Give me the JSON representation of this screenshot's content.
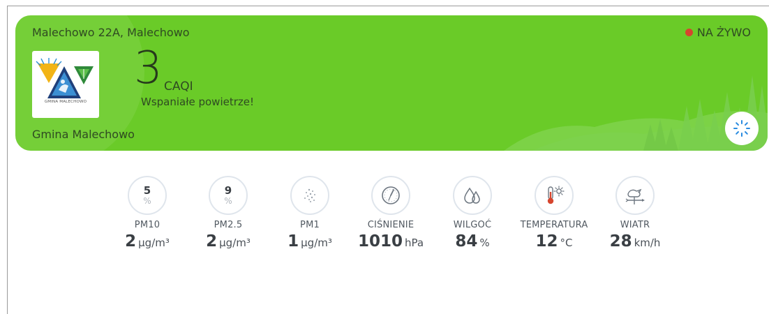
{
  "header": {
    "location": "Malechowo 22A, Malechowo",
    "live_label": "NA ŻYWO",
    "organization": "Gmina Malechowo"
  },
  "logo": {
    "caption": "GMINA MALECHOWO"
  },
  "aqi": {
    "value": "3",
    "unit": "CAQI",
    "description": "Wspaniałe powietrze!"
  },
  "colors": {
    "card_background": "#6acb28",
    "live_dot": "#d6452e",
    "refresh_icon": "#2a8be0"
  },
  "metrics": [
    {
      "id": "pm10",
      "index": "5",
      "index_unit": "%",
      "label": "PM10",
      "value": "2",
      "unit": "µg/m³"
    },
    {
      "id": "pm25",
      "index": "9",
      "index_unit": "%",
      "label": "PM2.5",
      "value": "2",
      "unit": "µg/m³"
    },
    {
      "id": "pm1",
      "icon": "dots-icon",
      "label": "PM1",
      "value": "1",
      "unit": "µg/m³"
    },
    {
      "id": "pressure",
      "icon": "gauge-icon",
      "label": "CIŚNIENIE",
      "value": "1010",
      "unit": "hPa"
    },
    {
      "id": "humidity",
      "icon": "water-drops-icon",
      "label": "WILGOĆ",
      "value": "84",
      "unit": "%"
    },
    {
      "id": "temperature",
      "icon": "thermometer-sun-icon",
      "label": "TEMPERATURA",
      "value": "12",
      "unit": "°C"
    },
    {
      "id": "wind",
      "icon": "weathervane-icon",
      "label": "WIATR",
      "value": "28",
      "unit": "km/h"
    }
  ]
}
